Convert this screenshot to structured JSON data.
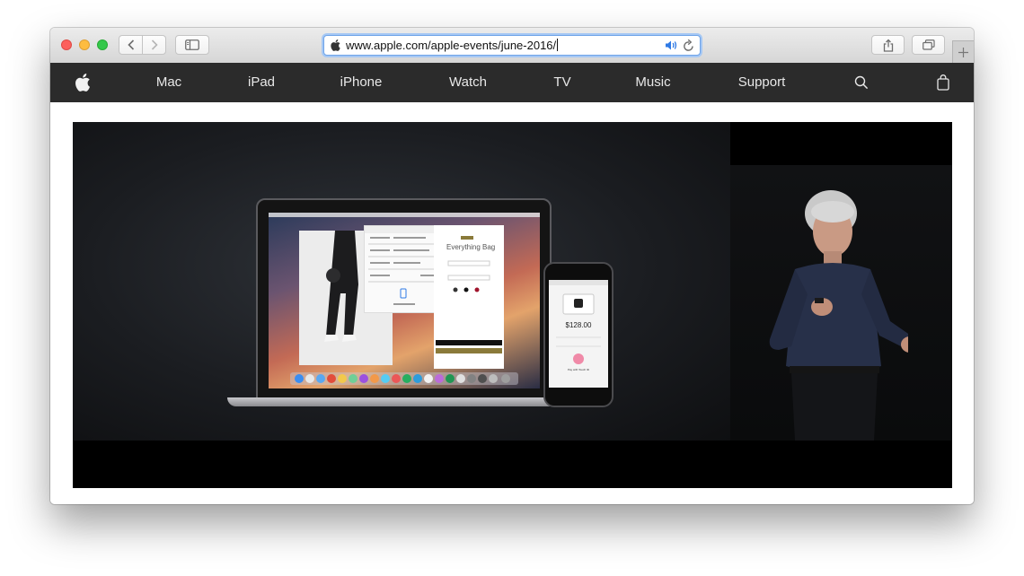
{
  "browser": {
    "url": "www.apple.com/apple-events/june-2016/"
  },
  "nav": {
    "items": [
      {
        "label": "Mac"
      },
      {
        "label": "iPad"
      },
      {
        "label": "iPhone"
      },
      {
        "label": "Watch"
      },
      {
        "label": "TV"
      },
      {
        "label": "Music"
      },
      {
        "label": "Support"
      }
    ],
    "icons": [
      "apple-logo-icon",
      "search-icon",
      "shopping-bag-icon"
    ]
  },
  "video": {
    "shop_title": "Everything Bag",
    "phone_price": "$128.00",
    "phone_hint": "Pay with Touch ID"
  },
  "colors": {
    "nav_background": "#2b2b2b",
    "video_background": "#000000",
    "address_focus": "#6ea3e8"
  }
}
